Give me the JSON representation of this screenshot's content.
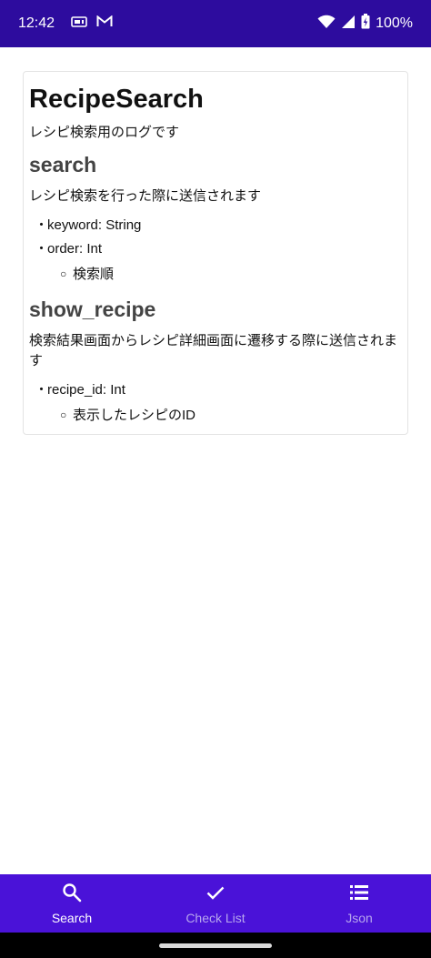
{
  "status_bar": {
    "time": "12:42",
    "battery": "100%",
    "icons": [
      "sim-card-icon",
      "gmail-icon",
      "wifi-icon",
      "signal-icon",
      "battery-icon"
    ]
  },
  "doc": {
    "title": "RecipeSearch",
    "description": "レシピ検索用のログです",
    "events": [
      {
        "name": "search",
        "description": "レシピ検索を行った際に送信されます",
        "params": [
          {
            "label": "keyword: String",
            "notes": []
          },
          {
            "label": "order: Int",
            "notes": [
              "検索順"
            ]
          }
        ]
      },
      {
        "name": "show_recipe",
        "description": "検索結果画面からレシピ詳細画面に遷移する際に送信されます",
        "params": [
          {
            "label": "recipe_id: Int",
            "notes": [
              "表示したレシピのID"
            ]
          }
        ]
      }
    ]
  },
  "bottom_nav": {
    "items": [
      {
        "label": "Search",
        "icon": "search-icon",
        "active": true
      },
      {
        "label": "Check List",
        "icon": "check-icon",
        "active": false
      },
      {
        "label": "Json",
        "icon": "list-icon",
        "active": false
      }
    ]
  },
  "colors": {
    "status_bar": "#2d0c9e",
    "nav_bar": "#4a12d8",
    "nav_inactive": "#b7a6ee",
    "heading_gray": "#444444"
  }
}
